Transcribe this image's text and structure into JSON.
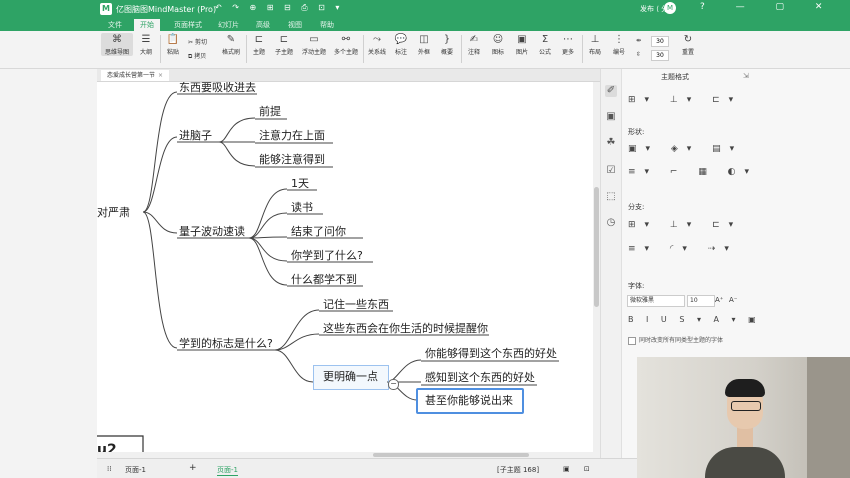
{
  "app": {
    "title": "亿图脑图MindMaster (Pro)",
    "logo": "M",
    "quick_access": "↶ ↷ ⊕ ⊞ ⊟ ⎙ ⊡ ▾",
    "top_right": "发布 ⟨ 分享",
    "avatar_letter": "M",
    "window_controls": "? — ▢ ✕"
  },
  "menu": {
    "tabs": [
      "文件",
      "开始",
      "页面样式",
      "幻灯片",
      "高级",
      "视图",
      "帮助"
    ],
    "active_index": 1
  },
  "ribbon": {
    "buttons": [
      {
        "label": "思维导图",
        "icon": "mindmap-icon",
        "glyph": "⌘",
        "active": true
      },
      {
        "label": "大纲",
        "icon": "outline-icon",
        "glyph": "☰"
      },
      {
        "label": "粘贴",
        "icon": "paste-icon",
        "glyph": "📋"
      },
      {
        "label": "格式刷",
        "icon": "format-brush-icon",
        "glyph": "✎"
      },
      {
        "label": "主题",
        "icon": "topic-icon",
        "glyph": "⊏"
      },
      {
        "label": "子主题",
        "icon": "subtopic-icon",
        "glyph": "⊏"
      },
      {
        "label": "浮动主题",
        "icon": "float-topic-icon",
        "glyph": "▭"
      },
      {
        "label": "多个主题",
        "icon": "multi-topic-icon",
        "glyph": "⚯"
      },
      {
        "label": "关系线",
        "icon": "relation-icon",
        "glyph": "⤳"
      },
      {
        "label": "标注",
        "icon": "callout-icon",
        "glyph": "💬"
      },
      {
        "label": "外框",
        "icon": "boundary-icon",
        "glyph": "◫"
      },
      {
        "label": "概要",
        "icon": "summary-icon",
        "glyph": "}"
      },
      {
        "label": "注释",
        "icon": "note-icon",
        "glyph": "✍"
      },
      {
        "label": "图标",
        "icon": "mark-icon",
        "glyph": "☺"
      },
      {
        "label": "图片",
        "icon": "image-icon",
        "glyph": "▣"
      },
      {
        "label": "公式",
        "icon": "formula-icon",
        "glyph": "Σ"
      },
      {
        "label": "更多",
        "icon": "more-icon",
        "glyph": "⋯"
      },
      {
        "label": "布局",
        "icon": "layout-icon",
        "glyph": "⊥"
      },
      {
        "label": "编号",
        "icon": "numbering-icon",
        "glyph": "⋮"
      },
      {
        "label": "重置",
        "icon": "reset-icon",
        "glyph": "↻"
      }
    ],
    "cut_label": "剪切",
    "copy_label": "拷贝",
    "spacing_h": "30",
    "spacing_v": "30"
  },
  "document": {
    "tab_label": "恋爱成长营第一节",
    "close_glyph": "×"
  },
  "mindmap": {
    "root_partial": "对严肃",
    "branches": {
      "absorb": "东西要吸收进去",
      "into_brain": "进脑子",
      "premise": "前提",
      "attention_on": "注意力在上面",
      "can_attend": "能够注意得到",
      "quantum": "量子波动速读",
      "day1": "1天",
      "reading": "读书",
      "asked": "结束了问你",
      "what_learned": "你学到了什么?",
      "learned_nothing": "什么都学不到",
      "sign": "学到的标志是什么?",
      "remember": "记住一些东西",
      "remind": "这些东西会在你生活的时候提醒你",
      "clearer": "更明确一点",
      "benefit": "你能够得到这个东西的好处",
      "perceive": "感知到这个东西的好处",
      "explain": "甚至你能够说出来"
    },
    "corner_text": "u2",
    "collapse_glyph": "−"
  },
  "panel": {
    "title": "主题格式",
    "pin": "⇲",
    "section_shape": "形状:",
    "section_branch": "分支:",
    "section_font": "字体:",
    "font_name": "微软雅黑",
    "font_size": "10",
    "font_grow": "A⁺",
    "font_shrink": "A⁻",
    "style_row": "B I U S ▾ A ▾ ▣",
    "layout_row": "⊞▾ ⊥▾ ⊏▾",
    "shape_row1": "▣▾ ◈▾ ▤▾",
    "shape_row2": "≡▾ ⌐ ▦ ◐▾",
    "branch_row1": "⊞▾ ⊥▾ ⊏▾",
    "branch_row2": "≡▾ ◜▾ ⇢▾",
    "checkbox_label": "同时改变所有同类型主题的字体",
    "side_icons": [
      "✐",
      "▣",
      "☘",
      "☑",
      "⬚",
      "◷"
    ]
  },
  "status": {
    "page_icon": "⁞⁞",
    "page_select": "页面-1",
    "add_glyph": "+",
    "page_tab": "页面-1",
    "subtopic_info": "[子主题 168]",
    "view_icons": "▣ ⊡"
  }
}
